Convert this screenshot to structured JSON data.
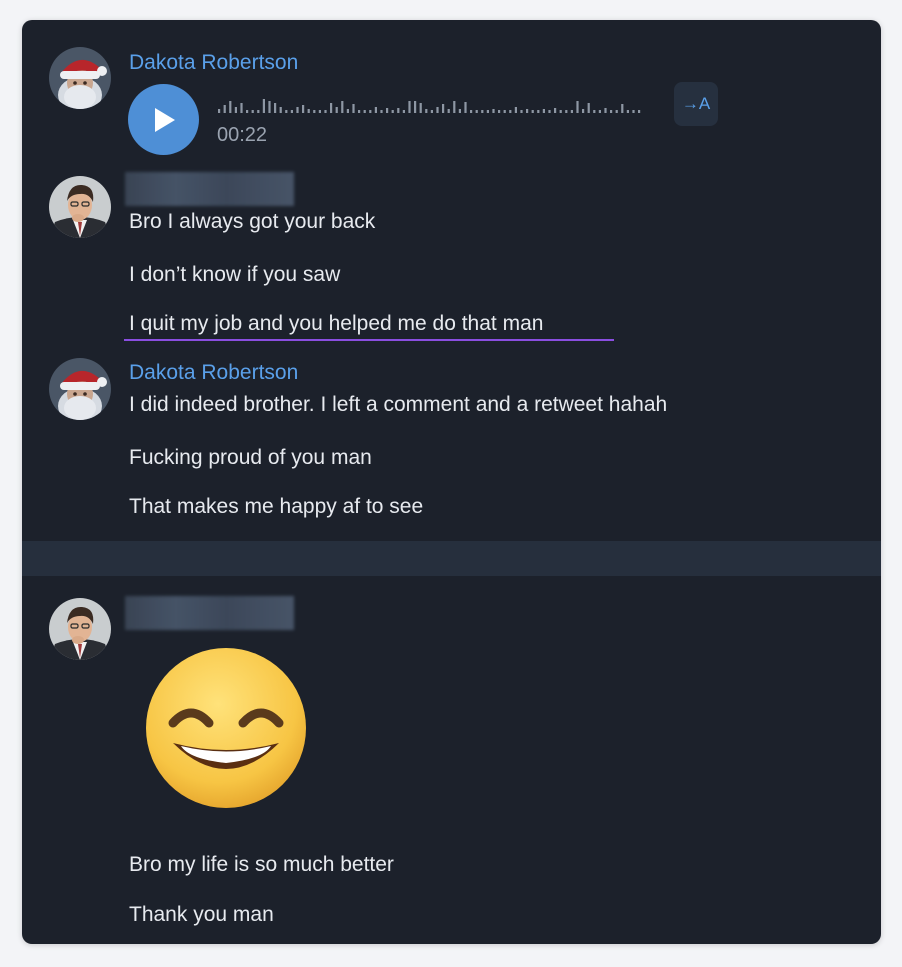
{
  "messages": {
    "group1": {
      "sender": "Dakota Robertson",
      "voice_duration": "00:22",
      "transcribe_label": "→A"
    },
    "group2": {
      "lines": [
        "Bro I always got your back",
        "I don’t know if you saw",
        "I quit my job and you helped me do that man"
      ]
    },
    "group3": {
      "sender": "Dakota Robertson",
      "lines": [
        "I did indeed brother. I left a comment and a retweet hahah",
        "Fucking proud of you man",
        "That makes me happy af to see"
      ]
    },
    "group4": {
      "sticker": "grinning-face-with-smiling-eyes",
      "lines": [
        "Bro my life is so much better",
        "Thank you man"
      ]
    }
  },
  "colors": {
    "background": "#1c212b",
    "sender_name": "#5aa0ea",
    "play_button": "#4e8fd6",
    "highlight_underline": "#8a4ee0"
  }
}
